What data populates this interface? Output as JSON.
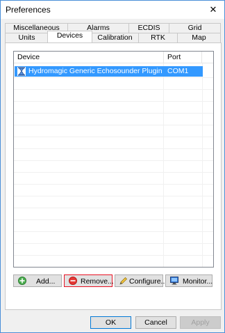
{
  "window": {
    "title": "Preferences",
    "close_glyph": "✕"
  },
  "tabs": {
    "row1": [
      "Miscellaneous",
      "Alarms",
      "ECDIS",
      "Grid"
    ],
    "row2": [
      "Units",
      "Devices",
      "Calibration",
      "RTK",
      "Map"
    ],
    "active": "Devices"
  },
  "devices": {
    "columns": [
      "Device",
      "Port"
    ],
    "rows": [
      {
        "icon": "echosounder-device-icon",
        "device": "Hydromagic Generic Echosounder Plugin",
        "port": "COM1",
        "selected": true
      }
    ]
  },
  "actions": {
    "add": "Add...",
    "remove": "Remove...",
    "configure": "Configure...",
    "monitor": "Monitor..."
  },
  "dialog": {
    "ok": "OK",
    "cancel": "Cancel",
    "apply": "Apply"
  },
  "colors": {
    "selection": "#3399ff",
    "focus_border": "#e81123",
    "window_border": "#4a8fd8"
  }
}
